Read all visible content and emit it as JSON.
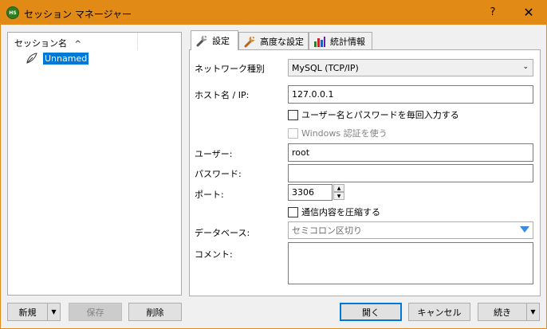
{
  "window": {
    "title": "セッション マネージャー",
    "icon_text": "HS",
    "help_label": "?",
    "close_label": "✕"
  },
  "tree": {
    "header": "セッション名",
    "sort_caret": "^",
    "items": [
      {
        "label": "Unnamed"
      }
    ]
  },
  "left_buttons": {
    "new_label": "新規",
    "save_label": "保存",
    "delete_label": "削除"
  },
  "tabs": [
    {
      "label": "設定",
      "icon": "wrench-icon"
    },
    {
      "label": "高度な設定",
      "icon": "wrench-icon"
    },
    {
      "label": "統計情報",
      "icon": "bar-chart-icon"
    }
  ],
  "form": {
    "network_type_label": "ネットワーク種別",
    "network_type_value": "MySQL (TCP/IP)",
    "host_label": "ホスト名 / IP:",
    "host_value": "127.0.0.1",
    "prompt_checkbox_label": "ユーザー名とパスワードを毎回入力する",
    "windows_auth_label": "Windows 認証を使う",
    "user_label": "ユーザー:",
    "user_value": "root",
    "password_label": "パスワード:",
    "password_value": "",
    "port_label": "ポート:",
    "port_value": "3306",
    "compress_label": "通信内容を圧縮する",
    "database_label": "データベース:",
    "database_placeholder": "セミコロン区切り",
    "comment_label": "コメント:",
    "comment_value": ""
  },
  "bottom_buttons": {
    "open_label": "開く",
    "cancel_label": "キャンセル",
    "more_label": "続き"
  },
  "colors": {
    "titlebar": "#e28a16",
    "selection": "#0078d7"
  }
}
